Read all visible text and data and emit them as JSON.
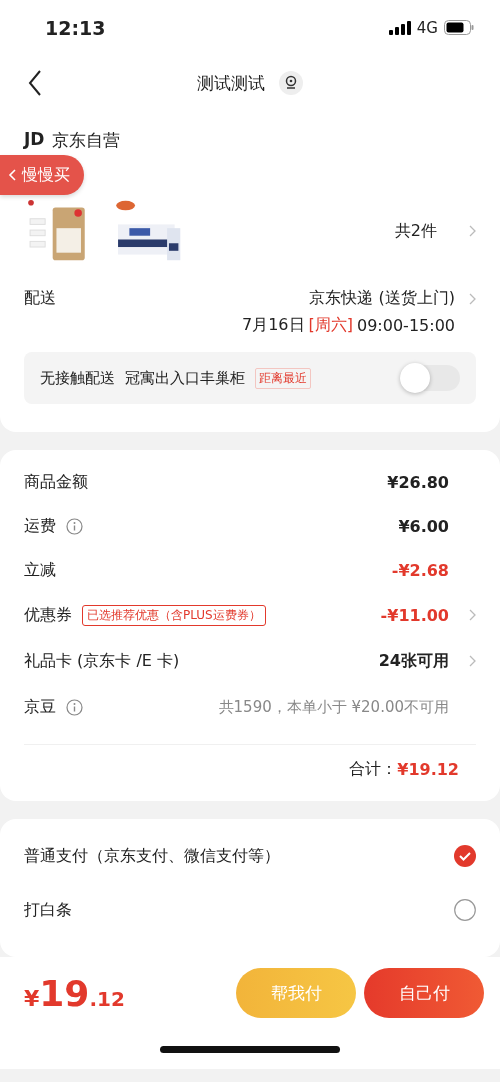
{
  "status_bar": {
    "time": "12:13",
    "network": "4G"
  },
  "nav": {
    "title": "测试测试"
  },
  "floating_tag": {
    "label": "慢慢买"
  },
  "store": {
    "logo": "JD",
    "name": "京东自营"
  },
  "products": {
    "count": "共2件"
  },
  "delivery": {
    "label": "配送",
    "method": "京东快递 (送货上门)",
    "date": "7月16日",
    "weekday": "[周六]",
    "time": "09:00-15:00"
  },
  "contactless": {
    "label": "无接触配送",
    "place": "冠寓出入口丰巢柜",
    "tag": "距离最近",
    "on": false
  },
  "fees": [
    {
      "label": "商品金额",
      "info": false,
      "value": "¥26.80",
      "kind": "normal",
      "arrow": false
    },
    {
      "label": "运费",
      "info": true,
      "value": "¥6.00",
      "kind": "normal",
      "arrow": false
    },
    {
      "label": "立减",
      "info": false,
      "value": "-¥2.68",
      "kind": "discount",
      "arrow": false
    },
    {
      "label": "优惠券",
      "info": false,
      "tag": "已选推荐优惠（含PLUS运费券）",
      "value": "-¥11.00",
      "kind": "discount",
      "arrow": true
    },
    {
      "label": "礼品卡 (京东卡 /E 卡)",
      "info": false,
      "value": "24张可用",
      "kind": "normal",
      "arrow": true
    },
    {
      "label": "京豆",
      "info": true,
      "value": "共1590，本单小于 ¥20.00不可用",
      "kind": "muted",
      "arrow": false
    }
  ],
  "total": {
    "label": "合计：",
    "value": "¥19.12"
  },
  "payment": [
    {
      "label": "普通支付（京东支付、微信支付等）",
      "selected": true
    },
    {
      "label": "打白条",
      "selected": false
    }
  ],
  "bottom": {
    "currency": "¥",
    "integer": "19",
    "decimal": ".12",
    "buttons": [
      {
        "label": "帮我付",
        "kind": "secondary"
      },
      {
        "label": "自己付",
        "kind": "primary"
      }
    ]
  }
}
